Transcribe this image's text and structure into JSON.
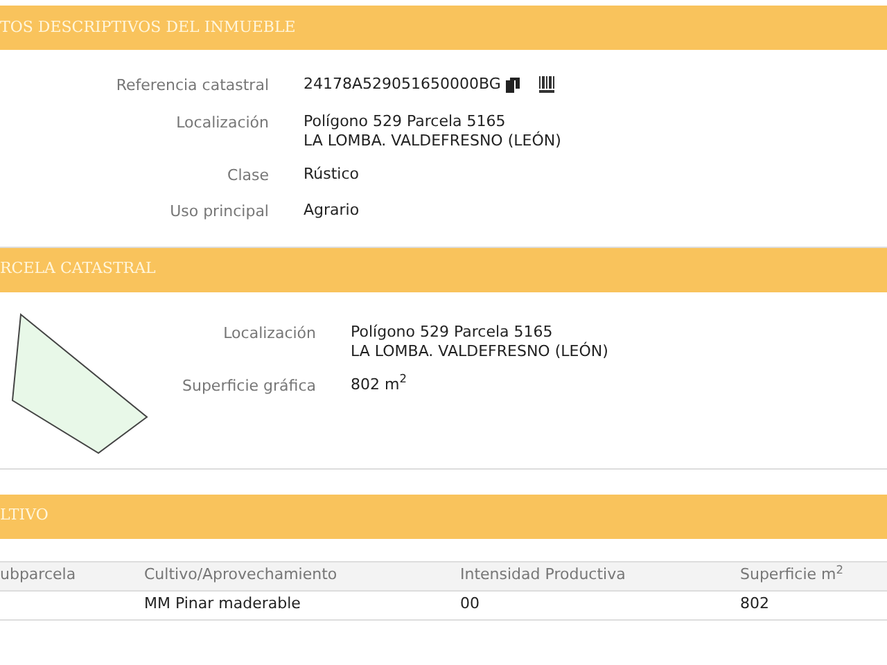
{
  "sections": [
    {
      "title": "TOS DESCRIPTIVOS DEL INMUEBLE",
      "kind": "fields",
      "fields": [
        {
          "label": "Referencia catastral",
          "lines": [
            "24178A529051650000BG"
          ],
          "icons": true
        },
        {
          "label": "Localización",
          "lines": [
            "Polígono 529 Parcela 5165",
            "LA LOMBA. VALDEFRESNO (LEÓN)"
          ]
        },
        {
          "label": "Clase",
          "lines": [
            "Rústico"
          ]
        },
        {
          "label": "Uso principal",
          "lines": [
            "Agrario"
          ]
        }
      ]
    },
    {
      "title": "RCELA CATASTRAL",
      "kind": "parcel",
      "fields": [
        {
          "label": "Localización",
          "lines": [
            "Polígono 529 Parcela 5165",
            "LA LOMBA. VALDEFRESNO (LEÓN)"
          ]
        },
        {
          "label": "Superficie gráfica",
          "lines": [
            "802 m$^{2}$"
          ]
        }
      ]
    },
    {
      "title": "LTIVO",
      "kind": "table",
      "columns": [
        "ubparcela",
        "Cultivo/Aprovechamiento",
        "Intensidad Productiva",
        "Superficie m$^{2}$"
      ],
      "rows": [
        [
          "",
          "MM Pinar maderable",
          "00",
          "802"
        ]
      ]
    }
  ]
}
